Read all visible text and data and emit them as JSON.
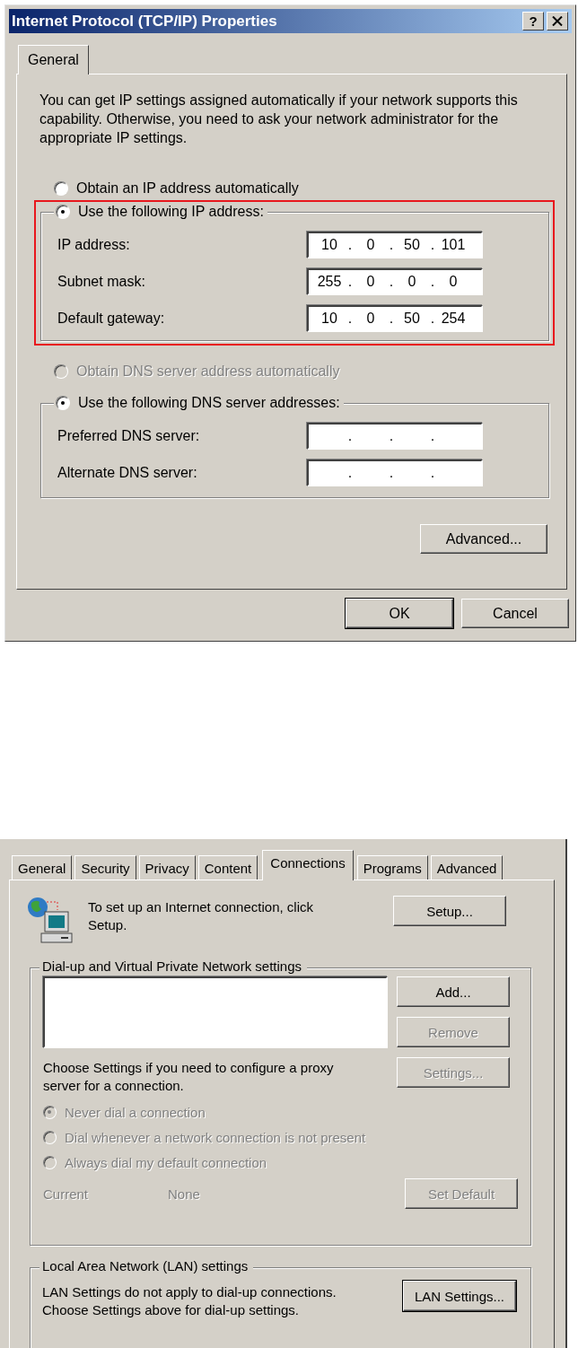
{
  "ip_dialog": {
    "title": "Internet Protocol (TCP/IP) Properties",
    "help_button": "?",
    "tabs": [
      {
        "label": "General",
        "selected": true
      }
    ],
    "intro": "You can get IP settings assigned automatically if your network supports this capability. Otherwise, you need to ask your network administrator for the appropriate IP settings.",
    "ip_options": [
      {
        "label": "Obtain an IP address automatically",
        "selected": false,
        "disabled": false
      },
      {
        "label": "Use the following IP address:",
        "selected": true,
        "disabled": false
      }
    ],
    "ip_group": {
      "highlighted": true,
      "fields": [
        {
          "label": "IP address:",
          "octets": [
            "10",
            "0",
            "50",
            "101"
          ]
        },
        {
          "label": "Subnet mask:",
          "octets": [
            "255",
            "0",
            "0",
            "0"
          ]
        },
        {
          "label": "Default gateway:",
          "octets": [
            "10",
            "0",
            "50",
            "254"
          ]
        }
      ]
    },
    "dns_options": [
      {
        "label": "Obtain DNS server address automatically",
        "selected": false,
        "disabled": true
      },
      {
        "label": "Use the following DNS server addresses:",
        "selected": true,
        "disabled": false
      }
    ],
    "dns_fields": [
      {
        "label": "Preferred DNS server:"
      },
      {
        "label": "Alternate DNS server:"
      }
    ],
    "separator": ".",
    "advanced_button": {
      "label": "Advanced...",
      "disabled": false,
      "default": false
    },
    "footer_buttons": [
      {
        "label": "OK",
        "default": true
      },
      {
        "label": "Cancel",
        "default": false
      }
    ]
  },
  "internet_options": {
    "tabs": [
      {
        "label": "General",
        "selected": false
      },
      {
        "label": "Security",
        "selected": false
      },
      {
        "label": "Privacy",
        "selected": false
      },
      {
        "label": "Content",
        "selected": false
      },
      {
        "label": "Connections",
        "selected": true
      },
      {
        "label": "Programs",
        "selected": false
      },
      {
        "label": "Advanced",
        "selected": false
      }
    ],
    "setup_text": "To set up an Internet connection, click Setup.",
    "setup_button": {
      "label": "Setup...",
      "disabled": false,
      "default": false
    },
    "dialup": {
      "title": "Dial-up and Virtual Private Network settings",
      "buttons": [
        {
          "label": "Add...",
          "disabled": false
        },
        {
          "label": "Remove",
          "disabled": true
        },
        {
          "label": "Settings...",
          "disabled": true
        }
      ],
      "proxy_text": "Choose Settings if you need to configure a proxy server for a connection.",
      "dial_options": [
        {
          "label": "Never dial a connection",
          "selected": true,
          "disabled": true
        },
        {
          "label": "Dial whenever a network connection is not present",
          "selected": false,
          "disabled": true
        },
        {
          "label": "Always dial my default connection",
          "selected": false,
          "disabled": true
        }
      ],
      "current": {
        "label": "Current",
        "value": "None",
        "disabled": true
      },
      "set_default_button": {
        "label": "Set Default",
        "disabled": true
      }
    },
    "lan": {
      "title": "Local Area Network (LAN) settings",
      "text": "LAN Settings do not apply to dial-up connections. Choose Settings above for dial-up settings.",
      "button": {
        "label": "LAN Settings...",
        "default": true
      }
    }
  }
}
